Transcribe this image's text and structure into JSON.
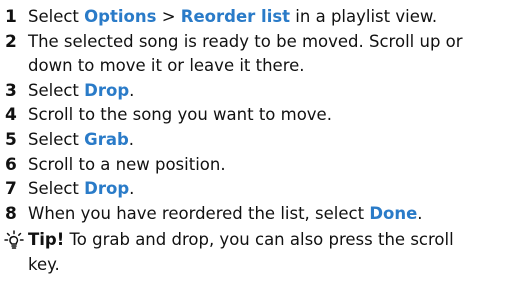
{
  "steps": [
    {
      "num": "1",
      "a": "Select ",
      "k1": "Options",
      "b": " > ",
      "k2": "Reorder list",
      "c": " in a playlist view."
    },
    {
      "num": "2",
      "line1": "The selected song is ready to be moved. Scroll up or",
      "line2": "down to move it or leave it there."
    },
    {
      "num": "3",
      "a": "Select ",
      "k1": "Drop",
      "c": "."
    },
    {
      "num": "4",
      "text": "Scroll to the song you want to move."
    },
    {
      "num": "5",
      "a": "Select ",
      "k1": "Grab",
      "c": "."
    },
    {
      "num": "6",
      "text": "Scroll to a new position."
    },
    {
      "num": "7",
      "a": "Select ",
      "k1": "Drop",
      "c": "."
    },
    {
      "num": "8",
      "a": "When you have reordered the list, select ",
      "k1": "Done",
      "c": "."
    }
  ],
  "tip": {
    "icon": "lightbulb-icon",
    "label": "Tip!",
    "line1": " To grab and drop, you can also press the scroll",
    "line2": "key."
  },
  "colors": {
    "keyword": "#2a7bc8",
    "text": "#111111"
  }
}
